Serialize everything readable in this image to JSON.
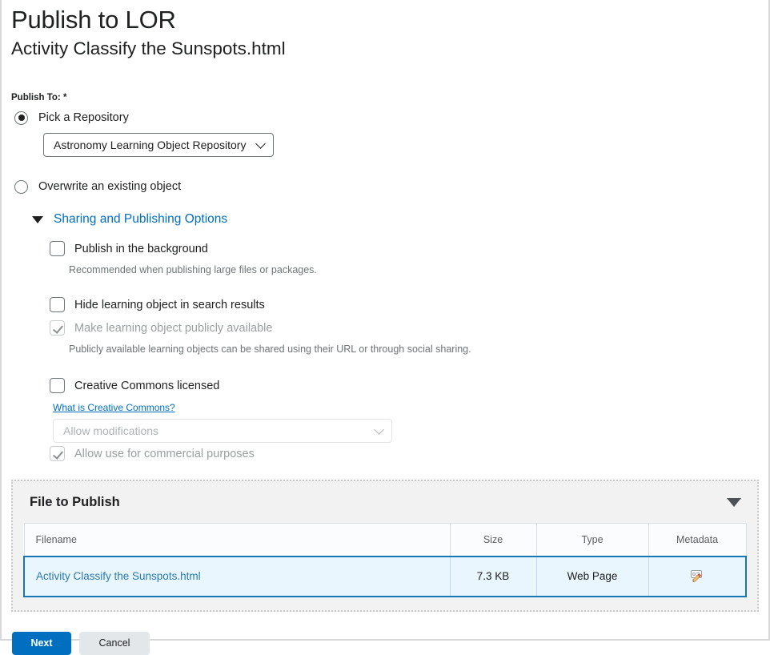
{
  "header": {
    "title": "Publish to LOR",
    "subtitle": "Activity Classify the Sunspots.html"
  },
  "publish_to": {
    "label": "Publish To: *",
    "options": [
      {
        "label": "Pick a Repository",
        "selected": true
      },
      {
        "label": "Overwrite an existing object",
        "selected": false
      }
    ],
    "repository_select": {
      "value": "Astronomy Learning Object Repository"
    }
  },
  "sharing_section": {
    "title": "Sharing and Publishing Options",
    "expanded": true,
    "items": [
      {
        "label": "Publish in the background",
        "checked": false,
        "disabled": false,
        "help": "Recommended when publishing large files or packages."
      },
      {
        "label": "Hide learning object in search results",
        "checked": false,
        "disabled": false,
        "help": ""
      },
      {
        "label": "Make learning object publicly available",
        "checked": true,
        "disabled": true,
        "help": "Publicly available learning objects can be shared using their URL or through social sharing."
      },
      {
        "label": "Creative Commons licensed",
        "checked": false,
        "disabled": false,
        "help": ""
      }
    ],
    "cc_link": "What is Creative Commons?",
    "cc_select": {
      "value": "Allow modifications",
      "disabled": true
    },
    "cc_commercial": {
      "label": "Allow use for commercial purposes",
      "checked": true,
      "disabled": true
    }
  },
  "file_panel": {
    "title": "File to Publish",
    "columns": [
      "Filename",
      "Size",
      "Type",
      "Metadata"
    ],
    "rows": [
      {
        "filename": "Activity Classify the Sunspots.html",
        "size": "7.3 KB",
        "type": "Web Page",
        "metadata_icon": "metadata-edit-icon"
      }
    ]
  },
  "actions": {
    "next_label": "Next",
    "cancel_label": "Cancel"
  },
  "colors": {
    "accent": "#006fbf",
    "link": "#2a7ab0",
    "selected_row_bg": "#e9f6fd",
    "selected_row_border": "#1976b5",
    "panel_bg": "#f2f2f2"
  }
}
